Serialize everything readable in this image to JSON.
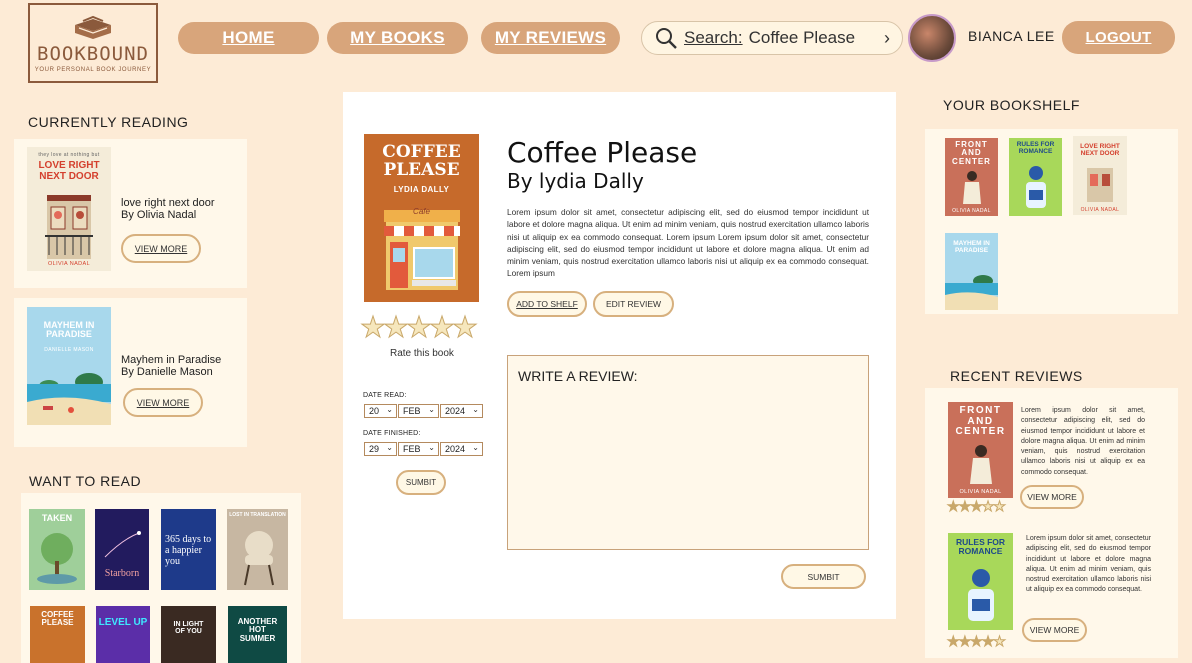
{
  "brand": {
    "name": "BOOKBOUND",
    "tagline": "YOUR PERSONAL BOOK JOURNEY",
    "book_icon": "book-stack-icon"
  },
  "nav": {
    "home": "HOME",
    "my_books": "MY BOOKS",
    "my_reviews": "MY REVIEWS"
  },
  "search": {
    "label": "Search:",
    "value": "Coffee Please",
    "icon": "search-icon",
    "go_icon": "chevron-right-icon"
  },
  "user": {
    "name": "BIANCA LEE",
    "logout": "LOGOUT"
  },
  "currently_reading": {
    "title": "CURRENTLY READING",
    "books": [
      {
        "cover_top": "they love at nothing but",
        "cover_title": "LOVE RIGHT NEXT DOOR",
        "cover_author": "OLIVIA NADAL",
        "title": "love right next door",
        "author": "By Olivia Nadal",
        "button": "VIEW MORE"
      },
      {
        "cover_title": "MAYHEM IN PARADISE",
        "cover_author": "DANIELLE MASON",
        "title": "Mayhem in Paradise",
        "author": "By Danielle Mason",
        "button": "VIEW MORE"
      }
    ]
  },
  "want_to_read": {
    "title": "WANT TO READ",
    "books": [
      {
        "cover_title": "TAKEN"
      },
      {
        "cover_title": "Starborn"
      },
      {
        "cover_title": "365 days to a happier you"
      },
      {
        "cover_title": "LOST IN TRANSLATION"
      },
      {
        "cover_title": "COFFEE PLEASE"
      },
      {
        "cover_title": "LEVEL UP"
      },
      {
        "cover_title": "IN LIGHT OF YOU"
      },
      {
        "cover_title": "ANOTHER HOT SUMMER"
      }
    ]
  },
  "detail": {
    "cover_title": "COFFEE PLEASE",
    "cover_author": "LYDIA DALLY",
    "cover_sign": "Cafe",
    "title": "Coffee Please",
    "author": "By lydia Dally",
    "description": "Lorem ipsum dolor sit amet, consectetur adipiscing elit, sed do eiusmod tempor incididunt ut labore et dolore magna aliqua. Ut enim ad minim veniam, quis nostrud exercitation ullamco laboris nisi ut aliquip ex ea commodo consequat. Lorem ipsum Lorem ipsum dolor sit amet, consectetur adipiscing elit, sed do eiusmod tempor incididunt ut labore et dolore magna aliqua. Ut enim ad minim veniam, quis nostrud exercitation ullamco laboris nisi ut aliquip ex ea commodo consequat. Lorem ipsum",
    "add_to_shelf": "ADD TO SHELF",
    "edit_review": "EDIT REVIEW",
    "rating": 0,
    "rating_max": 5,
    "rate_label": "Rate this book",
    "date_read_label": "DATE READ:",
    "date_read": {
      "day": "20",
      "month": "FEB",
      "year": "2024"
    },
    "date_finished_label": "DATE FINISHED:",
    "date_finished": {
      "day": "29",
      "month": "FEB",
      "year": "2024"
    },
    "dates_submit": "SUMBIT",
    "review_heading": "WRITE A REVIEW:",
    "review_submit": "SUMBIT"
  },
  "bookshelf": {
    "title": "YOUR BOOKSHELF",
    "books": [
      {
        "cover_title": "FRONT AND CENTER",
        "cover_author": "OLIVIA NADAL"
      },
      {
        "cover_title": "RULES FOR ROMANCE"
      },
      {
        "cover_title": "LOVE RIGHT NEXT DOOR",
        "cover_author": "OLIVIA NADAL"
      },
      {
        "cover_title": "MAYHEM IN PARADISE"
      }
    ]
  },
  "recent_reviews": {
    "title": "RECENT REVIEWS",
    "items": [
      {
        "cover_title": "FRONT AND CENTER",
        "cover_author": "OLIVIA NADAL",
        "rating": 3,
        "rating_max": 5,
        "text": "Lorem ipsum dolor sit amet, consectetur adipiscing elit, sed do eiusmod tempor incididunt ut labore et dolore magna aliqua. Ut enim ad minim veniam, quis nostrud exercitation ullamco laboris nisi ut aliquip ex ea commodo consequat.",
        "button": "VIEW MORE"
      },
      {
        "cover_title": "RULES FOR ROMANCE",
        "rating": 4,
        "rating_max": 5,
        "text": "Lorem ipsum dolor sit amet, consectetur adipiscing elit, sed do eiusmod tempor incididunt ut labore et dolore magna aliqua. Ut enim ad minim veniam, quis nostrud exercitation ullamco laboris nisi ut aliquip ex ea commodo consequat.",
        "button": "VIEW MORE"
      }
    ]
  },
  "colors": {
    "background": "#fdebd6",
    "accent": "#d8a57b",
    "panel": "#fff8ea",
    "star": "#c9a86a"
  }
}
